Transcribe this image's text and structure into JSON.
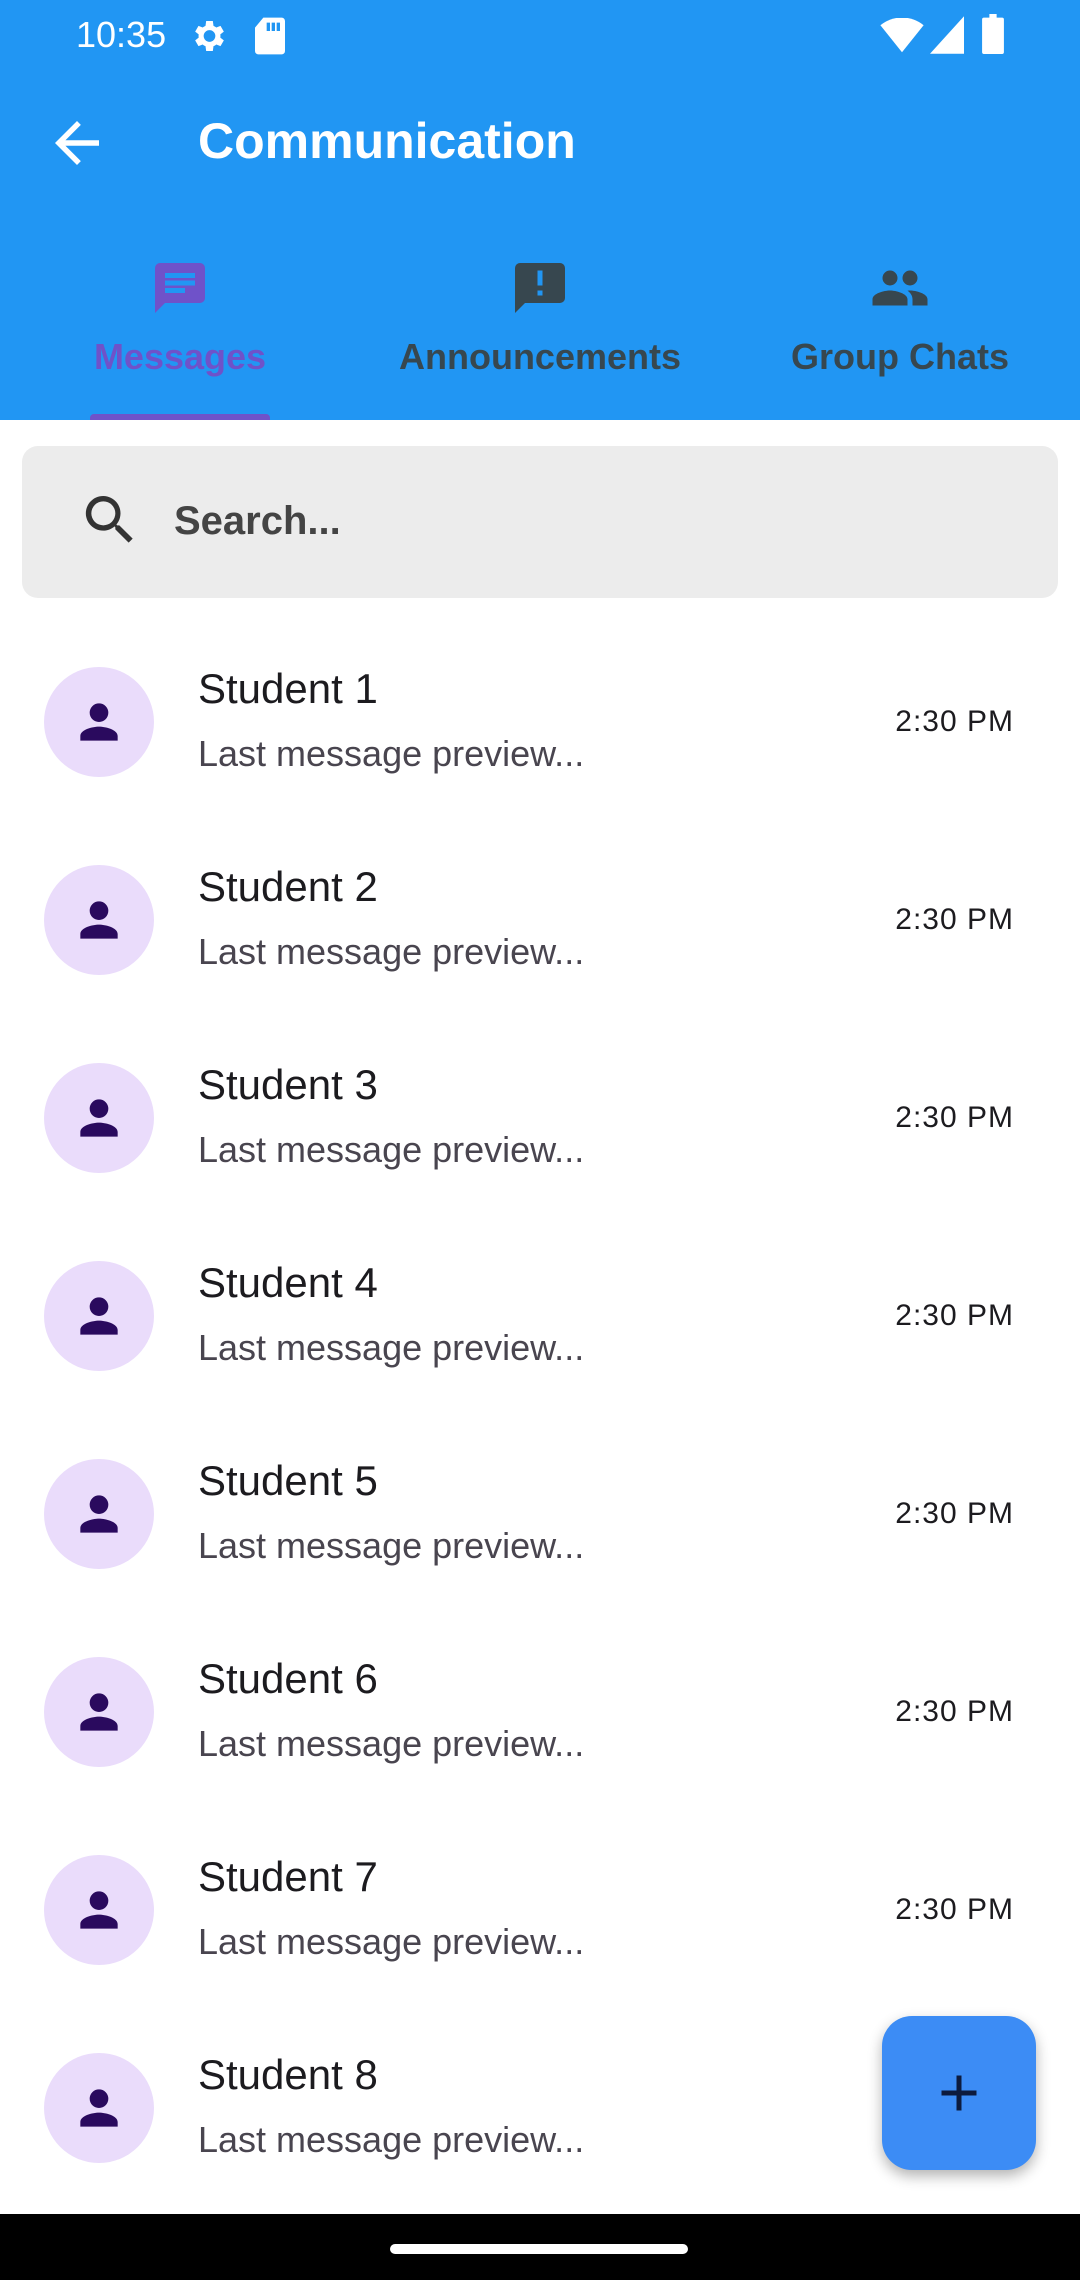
{
  "status_bar": {
    "time": "10:35",
    "icons": [
      "settings-icon",
      "sd-card-icon",
      "wifi-icon",
      "signal-icon",
      "battery-icon"
    ]
  },
  "toolbar": {
    "title": "Communication",
    "back_icon": "arrow-back-icon"
  },
  "tabs": [
    {
      "label": "Messages",
      "icon": "message-icon",
      "selected": true
    },
    {
      "label": "Announcements",
      "icon": "announcement-icon",
      "selected": false
    },
    {
      "label": "Group Chats",
      "icon": "group-icon",
      "selected": false
    }
  ],
  "search": {
    "placeholder": "Search...",
    "icon": "search-icon"
  },
  "conversations": [
    {
      "name": "Student 1",
      "preview": "Last message preview...",
      "time": "2:30 PM"
    },
    {
      "name": "Student 2",
      "preview": "Last message preview...",
      "time": "2:30 PM"
    },
    {
      "name": "Student 3",
      "preview": "Last message preview...",
      "time": "2:30 PM"
    },
    {
      "name": "Student 4",
      "preview": "Last message preview...",
      "time": "2:30 PM"
    },
    {
      "name": "Student 5",
      "preview": "Last message preview...",
      "time": "2:30 PM"
    },
    {
      "name": "Student 6",
      "preview": "Last message preview...",
      "time": "2:30 PM"
    },
    {
      "name": "Student 7",
      "preview": "Last message preview...",
      "time": "2:30 PM"
    },
    {
      "name": "Student 8",
      "preview": "Last message preview...",
      "time": ""
    }
  ],
  "fab": {
    "icon": "add-icon"
  },
  "colors": {
    "app_bar": "#2196F3",
    "tab_selected": "#6f52c9",
    "tab_unselected": "#37474f",
    "avatar_bg": "#eadcfb",
    "avatar_fg": "#2a0a5e",
    "fab": "#3c8cf5"
  }
}
